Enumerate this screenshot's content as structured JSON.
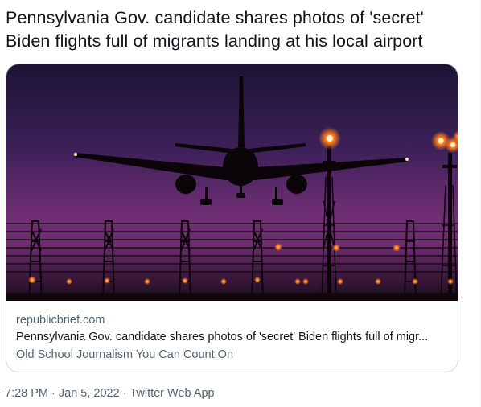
{
  "tweet": {
    "text_line1": "Pennsylvania Gov. candidate shares photos of 'secret'",
    "text_line2": "Biden flights full of migrants landing at his local airport"
  },
  "card": {
    "domain": "republicbrief.com",
    "title": "Pennsylvania Gov. candidate shares photos of 'secret' Biden flights full of migr...",
    "description": "Old School Journalism You Can Count On",
    "image_colors": {
      "sky_top": "#1e1436",
      "sky_mid": "#5a2a6e",
      "sky_low": "#8a3a7a",
      "horizon": "#3a1a3e",
      "lights": "#ff7a1a"
    }
  },
  "meta": {
    "time": "7:28 PM",
    "sep1": " · ",
    "date": "Jan 5, 2022",
    "sep2": " · ",
    "source": "Twitter Web App"
  },
  "colors": {
    "text": "#0f1419",
    "secondary": "#536471",
    "border": "#cfd9de"
  }
}
